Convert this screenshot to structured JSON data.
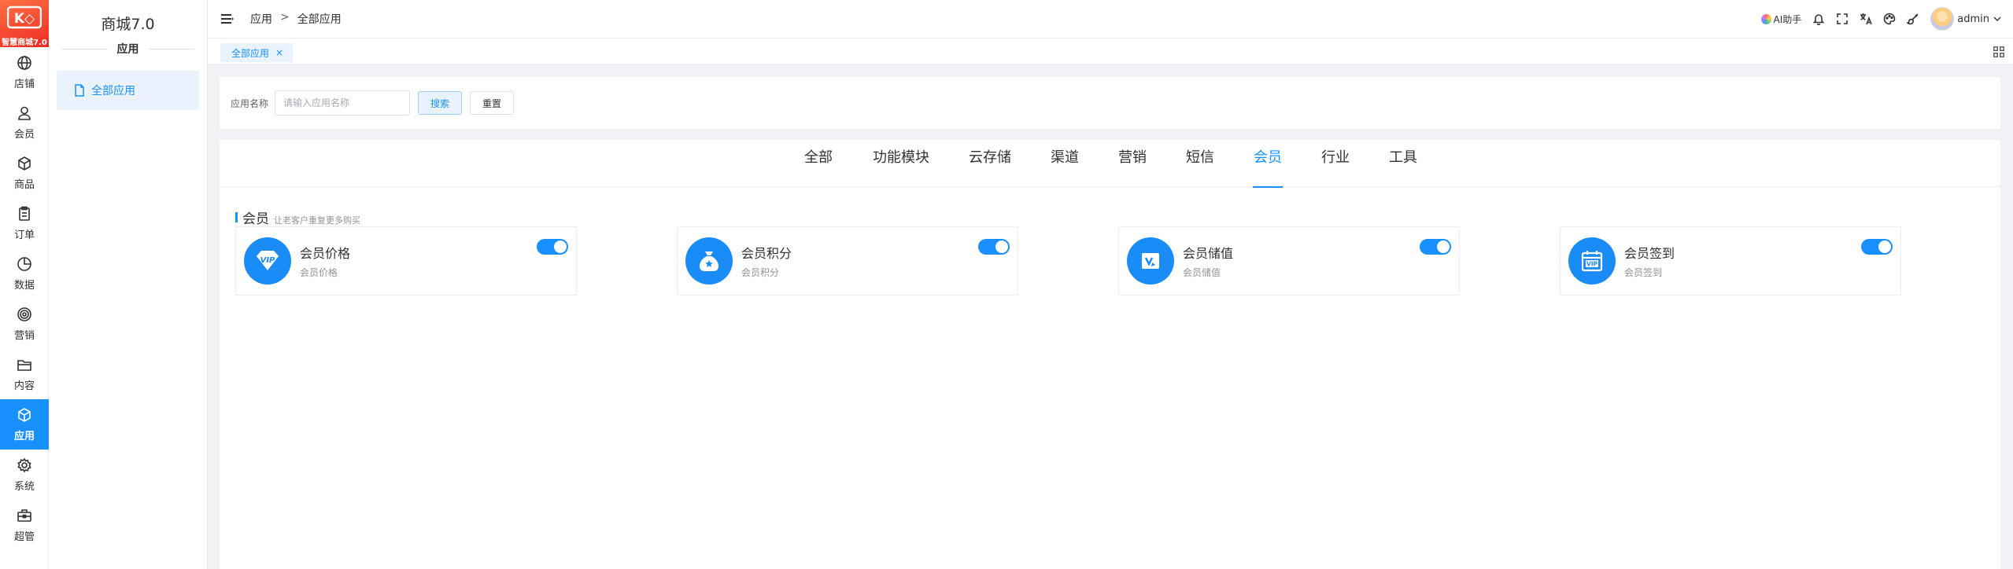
{
  "brand": {
    "logo_text": "智慧商城7.0",
    "accent": "#1890ff",
    "logo_color": "#ee2a24"
  },
  "rail": {
    "items": [
      {
        "label": "店铺",
        "icon": "globe-icon"
      },
      {
        "label": "会员",
        "icon": "user-icon"
      },
      {
        "label": "商品",
        "icon": "box-icon"
      },
      {
        "label": "订单",
        "icon": "clipboard-icon"
      },
      {
        "label": "数据",
        "icon": "pie-chart-icon"
      },
      {
        "label": "营销",
        "icon": "target-icon"
      },
      {
        "label": "内容",
        "icon": "folder-icon"
      },
      {
        "label": "应用",
        "icon": "cube-icon",
        "active": true
      },
      {
        "label": "系统",
        "icon": "gear-icon"
      },
      {
        "label": "超管",
        "icon": "briefcase-icon"
      }
    ]
  },
  "sidebar": {
    "title": "商城7.0",
    "section": "应用",
    "items": [
      {
        "label": "全部应用",
        "icon": "file-icon",
        "active": true
      }
    ]
  },
  "header": {
    "breadcrumb": [
      "应用",
      "全部应用"
    ],
    "breadcrumb_sep": ">",
    "ai_label": "AI助手",
    "icons": [
      "bell-icon",
      "fullscreen-icon",
      "translate-icon",
      "palette-icon",
      "brush-icon"
    ],
    "username": "admin"
  },
  "tagsbar": {
    "tags": [
      {
        "label": "全部应用",
        "close": "×"
      }
    ]
  },
  "search": {
    "label": "应用名称",
    "placeholder": "请输入应用名称",
    "search_btn": "搜索",
    "reset_btn": "重置"
  },
  "tabs": {
    "items": [
      "全部",
      "功能模块",
      "云存储",
      "渠道",
      "营销",
      "短信",
      "会员",
      "行业",
      "工具"
    ],
    "active": "会员"
  },
  "section": {
    "title": "会员",
    "subtitle": "让老客户重复更多购买"
  },
  "apps": [
    {
      "name": "会员价格",
      "desc": "会员价格",
      "icon": "vip-diamond-icon",
      "enabled": true
    },
    {
      "name": "会员积分",
      "desc": "会员积分",
      "icon": "money-bag-icon",
      "enabled": true
    },
    {
      "name": "会员储值",
      "desc": "会员储值",
      "icon": "card-icon",
      "enabled": true
    },
    {
      "name": "会员签到",
      "desc": "会员签到",
      "icon": "vip-calendar-icon",
      "enabled": true
    }
  ]
}
